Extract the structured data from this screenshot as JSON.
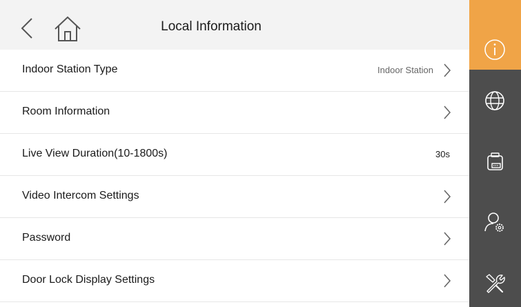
{
  "header": {
    "title": "Local Information"
  },
  "rows": [
    {
      "label": "Indoor Station Type",
      "value": "Indoor Station",
      "chevron": true
    },
    {
      "label": "Room Information",
      "value": "",
      "chevron": true
    },
    {
      "label": "Live View Duration(10-1800s)",
      "value": "30s",
      "chevron": false
    },
    {
      "label": "Video Intercom Settings",
      "value": "",
      "chevron": true
    },
    {
      "label": "Password",
      "value": "",
      "chevron": true
    },
    {
      "label": "Door Lock Display Settings",
      "value": "",
      "chevron": true
    }
  ],
  "sidebar": {
    "items": [
      {
        "icon": "info-icon",
        "active": true
      },
      {
        "icon": "globe-icon",
        "active": false
      },
      {
        "icon": "device-icon",
        "active": false
      },
      {
        "icon": "user-settings-icon",
        "active": false
      },
      {
        "icon": "tools-icon",
        "active": false
      }
    ]
  },
  "colors": {
    "accent": "#f0a447",
    "sidebar_bg": "#4d4d4d",
    "header_bg": "#f3f3f3"
  }
}
